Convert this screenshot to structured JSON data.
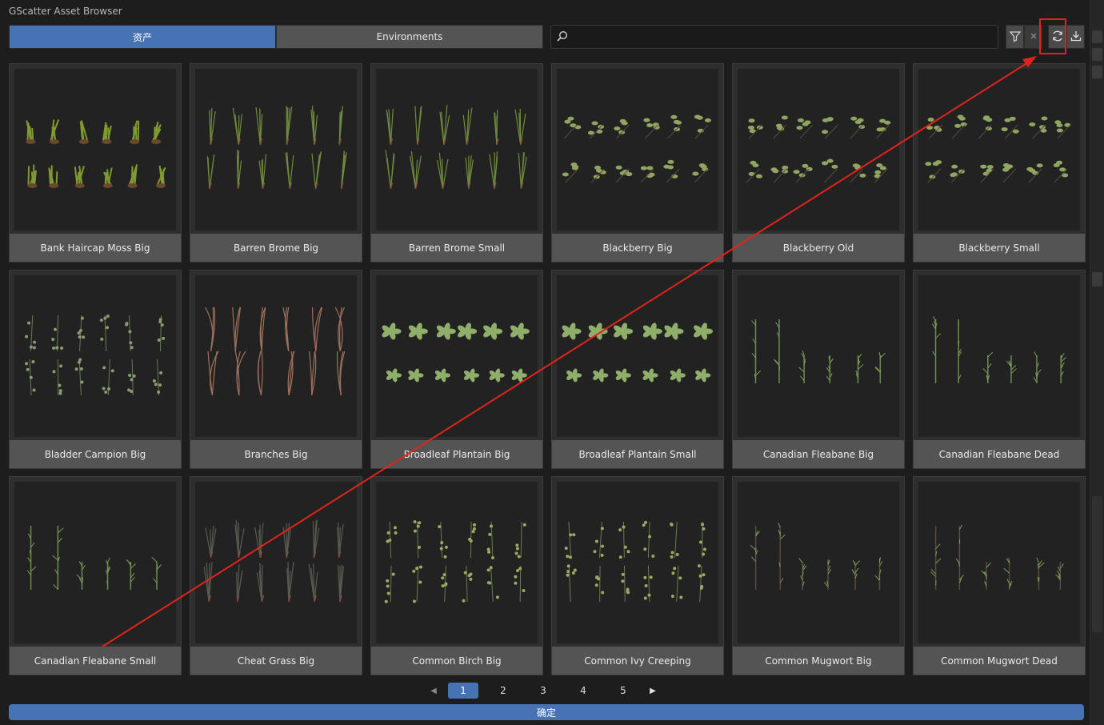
{
  "window": {
    "title": "GScatter Asset Browser"
  },
  "tabs": [
    {
      "label": "资产",
      "active": true
    },
    {
      "label": "Environments",
      "active": false
    }
  ],
  "search": {
    "value": "",
    "placeholder": ""
  },
  "toolbar": {
    "filter_icon": "filter-icon",
    "clear_icon": "close-icon",
    "refresh_icon": "refresh-icon",
    "download_icon": "download-icon"
  },
  "assets": [
    {
      "name": "Bank Haircap Moss Big",
      "style": "moss"
    },
    {
      "name": "Barren Brome Big",
      "style": "grass"
    },
    {
      "name": "Barren Brome Small",
      "style": "grass"
    },
    {
      "name": "Blackberry Big",
      "style": "berry"
    },
    {
      "name": "Blackberry Old",
      "style": "berry"
    },
    {
      "name": "Blackberry Small",
      "style": "berry"
    },
    {
      "name": "Bladder Campion Big",
      "style": "campion"
    },
    {
      "name": "Branches Big",
      "style": "branches"
    },
    {
      "name": "Broadleaf Plantain Big",
      "style": "plantain"
    },
    {
      "name": "Broadleaf Plantain Small",
      "style": "plantain"
    },
    {
      "name": "Canadian Fleabane Big",
      "style": "fleabane"
    },
    {
      "name": "Canadian Fleabane Dead",
      "style": "fleabane"
    },
    {
      "name": "Canadian Fleabane Small",
      "style": "fleabane"
    },
    {
      "name": "Cheat Grass Big",
      "style": "cheat"
    },
    {
      "name": "Common Birch Big",
      "style": "birch"
    },
    {
      "name": "Common Ivy Creeping",
      "style": "ivy"
    },
    {
      "name": "Common Mugwort Big",
      "style": "mugwort"
    },
    {
      "name": "Common Mugwort Dead",
      "style": "mugwort"
    }
  ],
  "pagination": {
    "pages": [
      "1",
      "2",
      "3",
      "4",
      "5"
    ],
    "current": "1",
    "prev_icon": "triangle-left-icon",
    "next_icon": "triangle-right-icon"
  },
  "confirm_label": "确定",
  "colors": {
    "accent": "#4772b3",
    "annotation": "#e0241b"
  }
}
